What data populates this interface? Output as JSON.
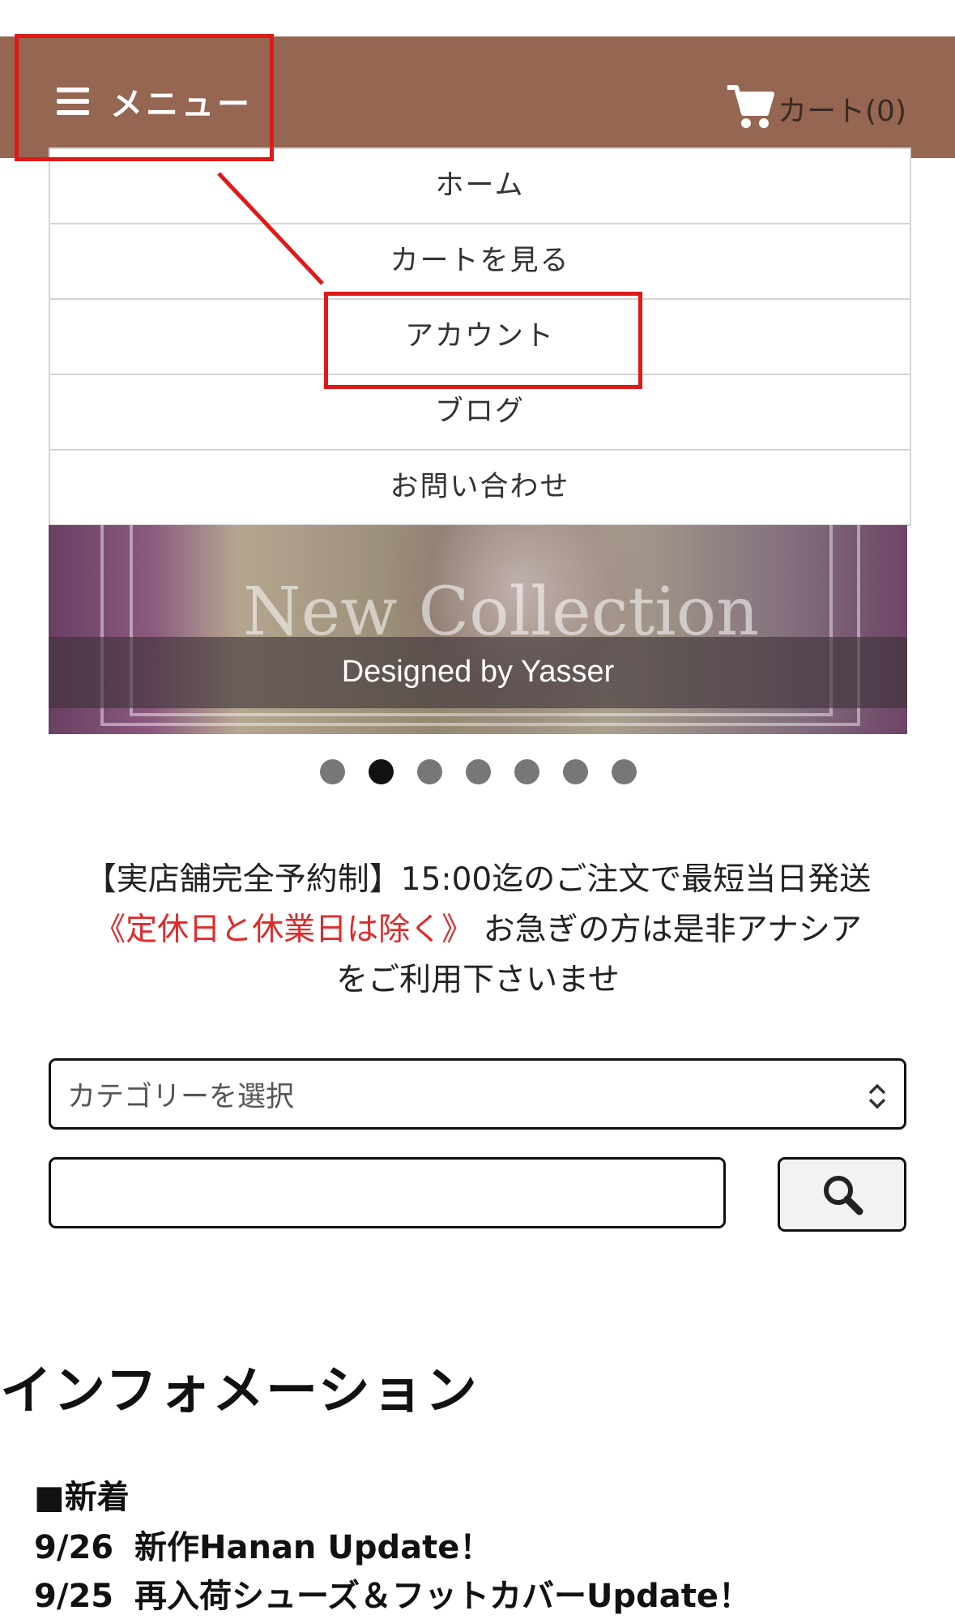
{
  "header": {
    "menu_label": "メニュー",
    "cart_label": "カート(0)",
    "background_color": "#956652"
  },
  "dropdown": {
    "items": [
      {
        "label": "ホーム"
      },
      {
        "label": "カートを見る"
      },
      {
        "label": "アカウント"
      },
      {
        "label": "ブログ"
      },
      {
        "label": "お問い合わせ"
      }
    ]
  },
  "banner": {
    "background_text": "New Collection",
    "caption": "Designed by Yasser"
  },
  "carousel": {
    "slide_count": 7,
    "active_index": 1
  },
  "notice": {
    "line1": "【実店舗完全予約制】15:00迄のご注文で最短当日発送",
    "red_text": "《定休日と休業日は除く》",
    "line2_rest": "お急ぎの方は是非アナシア",
    "line3": "をご利用下さいませ",
    "red_color": "#e02a2a"
  },
  "search": {
    "category_placeholder": "カテゴリーを選択",
    "query_value": ""
  },
  "information": {
    "title": "インフォメーション",
    "new_label": "■新着",
    "entries": [
      {
        "date": "9/26",
        "text": "新作Hanan Update！"
      },
      {
        "date": "9/25",
        "text": "再入荷シューズ＆フットカバーUpdate！"
      }
    ]
  },
  "annotation": {
    "highlight_color": "#e01919"
  }
}
